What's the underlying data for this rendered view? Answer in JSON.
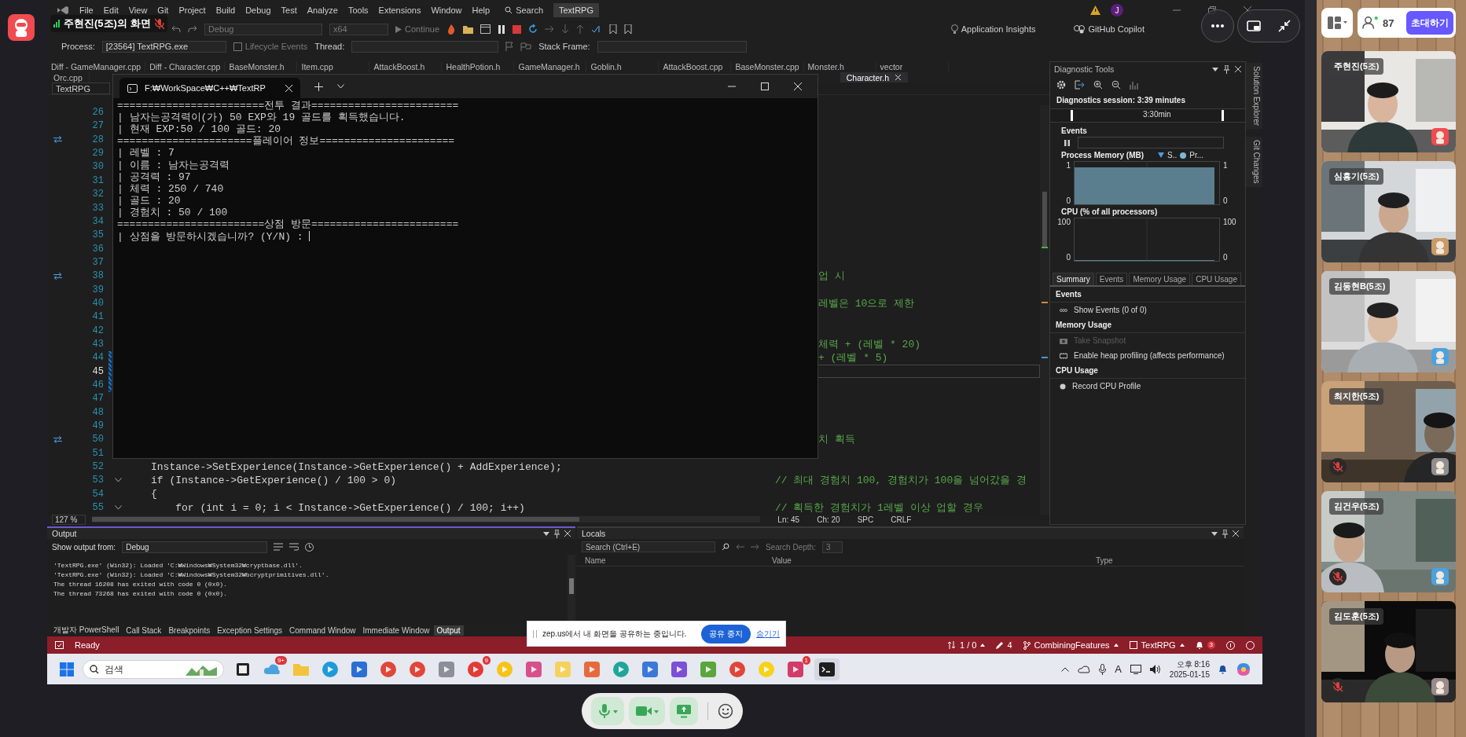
{
  "zep": {
    "presenter_label": "주현진(5조)의 화면",
    "presenter_mic_muted": true,
    "participant_count": "87",
    "invite_button": "초대하기",
    "share_notice": {
      "text": "zep.us에서 내 화면을 공유하는 중입니다.",
      "stop_button": "공유 중지",
      "hide_link": "숨기기"
    },
    "participants": [
      {
        "name": "주현진(5조)",
        "mic_muted": false
      },
      {
        "name": "심흥기(5조)",
        "mic_muted": false
      },
      {
        "name": "김동현B(5조)",
        "mic_muted": false
      },
      {
        "name": "최지한(5조)",
        "mic_muted": true
      },
      {
        "name": "김건우(5조)",
        "mic_muted": true
      },
      {
        "name": "김도훈(5조)",
        "mic_muted": true
      }
    ]
  },
  "visual_studio": {
    "menu": [
      "File",
      "Edit",
      "View",
      "Git",
      "Project",
      "Build",
      "Debug",
      "Test",
      "Analyze",
      "Tools",
      "Extensions",
      "Window",
      "Help"
    ],
    "search": "Search",
    "solution_badge": "TextRPG",
    "account_initial": "J",
    "toolbar": {
      "configuration": "Debug",
      "platform": "x64",
      "continue": "Continue",
      "insights": "Application Insights",
      "copilot": "GitHub Copilot"
    },
    "debug_bar": {
      "process_label": "Process:",
      "process": "[23564] TextRPG.exe",
      "lifecycle": "Lifecycle Events",
      "thread_label": "Thread:",
      "stack_label": "Stack Frame:"
    },
    "tabs_row_1": [
      {
        "label": "Diff - GameManager.cpp",
        "selected": false
      },
      {
        "label": "Diff - Character.cpp",
        "selected": false
      },
      {
        "label": "BaseMonster.h",
        "selected": false
      },
      {
        "label": "Item.cpp",
        "selected": false
      },
      {
        "label": "AttackBoost.h",
        "selected": false
      },
      {
        "label": "HealthPotion.h",
        "selected": false
      },
      {
        "label": "GameManager.h",
        "selected": false
      },
      {
        "label": "Goblin.h",
        "selected": false
      },
      {
        "label": "AttackBoost.cpp",
        "selected": false
      },
      {
        "label": "BaseMonster.cpp",
        "selected": false
      },
      {
        "label": "Monster.h",
        "selected": false
      },
      {
        "label": "vector",
        "selected": false
      }
    ],
    "tabs_row_2": [
      {
        "label": "Orc.cpp",
        "selected": false
      },
      {
        "label": "Character.h",
        "selected": true
      }
    ],
    "scope": "TextRPG",
    "editor": {
      "lines": [
        {
          "number": "26",
          "sync": false,
          "changed": false,
          "fold": false,
          "current": false
        },
        {
          "number": "27",
          "sync": false,
          "changed": false,
          "fold": false,
          "current": false
        },
        {
          "number": "28",
          "sync": true,
          "changed": false,
          "fold": false,
          "current": false
        },
        {
          "number": "29",
          "sync": false,
          "changed": false,
          "fold": false,
          "current": false
        },
        {
          "number": "30",
          "sync": false,
          "changed": false,
          "fold": false,
          "current": false
        },
        {
          "number": "31",
          "sync": false,
          "changed": false,
          "fold": false,
          "current": false
        },
        {
          "number": "32",
          "sync": false,
          "changed": false,
          "fold": false,
          "current": false
        },
        {
          "number": "33",
          "sync": false,
          "changed": false,
          "fold": false,
          "current": false
        },
        {
          "number": "34",
          "sync": false,
          "changed": false,
          "fold": false,
          "current": false
        },
        {
          "number": "35",
          "sync": false,
          "changed": false,
          "fold": false,
          "current": false
        },
        {
          "number": "36",
          "sync": false,
          "changed": false,
          "fold": false,
          "current": false
        },
        {
          "number": "37",
          "sync": false,
          "changed": false,
          "fold": false,
          "current": false
        },
        {
          "number": "38",
          "sync": true,
          "changed": false,
          "fold": false,
          "current": false,
          "tail": "업 시"
        },
        {
          "number": "39",
          "sync": false,
          "changed": false,
          "fold": false,
          "current": false
        },
        {
          "number": "40",
          "sync": false,
          "changed": false,
          "fold": false,
          "current": false,
          "tail": "레벨은 10으로 제한"
        },
        {
          "number": "41",
          "sync": false,
          "changed": false,
          "fold": false,
          "current": false
        },
        {
          "number": "42",
          "sync": false,
          "changed": false,
          "fold": false,
          "current": false
        },
        {
          "number": "43",
          "sync": false,
          "changed": false,
          "fold": false,
          "current": false,
          "tail": "체력 + (레벨 * 20)"
        },
        {
          "number": "44",
          "sync": false,
          "changed": true,
          "fold": false,
          "current": false,
          "tail": "+ (레벨 * 5)"
        },
        {
          "number": "45",
          "sync": false,
          "changed": true,
          "fold": false,
          "current": true
        },
        {
          "number": "46",
          "sync": false,
          "changed": true,
          "fold": false,
          "current": false
        },
        {
          "number": "47",
          "sync": false,
          "changed": false,
          "fold": false,
          "current": false
        },
        {
          "number": "48",
          "sync": false,
          "changed": false,
          "fold": false,
          "current": false
        },
        {
          "number": "49",
          "sync": false,
          "changed": false,
          "fold": false,
          "current": false
        },
        {
          "number": "50",
          "sync": true,
          "changed": false,
          "fold": false,
          "current": false,
          "tail": "치 획득"
        },
        {
          "number": "51",
          "sync": false,
          "changed": false,
          "fold": false,
          "current": false
        },
        {
          "number": "52",
          "sync": false,
          "changed": false,
          "fold": false,
          "current": false,
          "code": "Instance->SetExperience(Instance->GetExperience() + AddExperience);"
        },
        {
          "number": "53",
          "sync": false,
          "changed": false,
          "fold": true,
          "current": false,
          "code": "if (Instance->GetExperience() / 100 > 0)",
          "comment": "// 최대 경험치 100, 경험치가 100을 넘어갔을 경"
        },
        {
          "number": "54",
          "sync": false,
          "changed": false,
          "fold": false,
          "current": false,
          "code": "{"
        },
        {
          "number": "55",
          "sync": false,
          "changed": false,
          "fold": true,
          "current": false,
          "code": "    for (int i = 0; i < Instance->GetExperience() / 100; i++)",
          "comment": "// 획득한 경험치가 1레벨 이상 업할 경우"
        }
      ],
      "zoom": "127 %",
      "line": "Ln: 45",
      "column": "Ch: 20",
      "spacing": "SPC",
      "line_ending": "CRLF"
    },
    "diagnostics": {
      "title": "Diagnostic Tools",
      "session": "Diagnostics session: 3:39 minutes",
      "timeline_label": "3:30min",
      "events_label": "Events",
      "memory": {
        "title": "Process Memory (MB)",
        "legend": [
          "S..",
          "Pr..."
        ],
        "left_ticks": [
          "1",
          "0"
        ],
        "right_ticks": [
          "1",
          "0"
        ]
      },
      "cpu": {
        "title": "CPU (% of all processors)",
        "left_ticks": [
          "100",
          "0"
        ],
        "right_ticks": [
          "100",
          "0"
        ]
      },
      "tabs": [
        {
          "label": "Summary",
          "selected": true
        },
        {
          "label": "Events",
          "selected": false
        },
        {
          "label": "Memory Usage",
          "selected": false
        },
        {
          "label": "CPU Usage",
          "selected": false
        }
      ],
      "sections": [
        {
          "title": "Events",
          "items": [
            {
              "label": "Show Events (0 of 0)",
              "disabled": false
            }
          ]
        },
        {
          "title": "Memory Usage",
          "items": [
            {
              "label": "Take Snapshot",
              "disabled": true
            },
            {
              "label": "Enable heap profiling (affects performance)",
              "disabled": false
            }
          ]
        },
        {
          "title": "CPU Usage",
          "items": [
            {
              "label": "Record CPU Profile",
              "disabled": false
            }
          ]
        }
      ]
    },
    "side_tabs": [
      "Solution Explorer",
      "Git Changes"
    ],
    "output": {
      "title": "Output",
      "source_label": "Show output from:",
      "source": "Debug",
      "lines": [
        "'TextRPG.exe' (Win32): Loaded 'C:₩Windows₩System32₩cryptbase.dll'.",
        "'TextRPG.exe' (Win32): Loaded 'C:₩Windows₩System32₩bcryptprimitives.dll'.",
        "The thread 16208 has exited with code 0 (0x0).",
        "The thread 73268 has exited with code 0 (0x0)."
      ],
      "tabs": [
        {
          "label": "개발자 PowerShell",
          "selected": false
        },
        {
          "label": "Call Stack",
          "selected": false
        },
        {
          "label": "Breakpoints",
          "selected": false
        },
        {
          "label": "Exception Settings",
          "selected": false
        },
        {
          "label": "Command Window",
          "selected": false
        },
        {
          "label": "Immediate Window",
          "selected": false
        },
        {
          "label": "Output",
          "selected": true
        }
      ]
    },
    "locals": {
      "title": "Locals",
      "search_placeholder": "Search (Ctrl+E)",
      "depth_label": "Search Depth:",
      "depth": "3",
      "columns": [
        "Name",
        "Value",
        "Type"
      ]
    },
    "status_bar": {
      "state": "Ready",
      "changes": "1 / 0",
      "edits": "4",
      "branch": "CombiningFeatures",
      "repo": "TextRPG",
      "notifications": "3"
    }
  },
  "console": {
    "title": "F:₩WorkSpace₩C++₩TextRP",
    "cursor": true,
    "lines": [
      "========================전투 결과========================",
      "| 남자는공격력이(가) 50 EXP와 19 골드를 획득했습니다.",
      "| 현재 EXP:50 / 100 골드: 20",
      "======================플레이어 정보======================",
      "| 레벨 : 7",
      "| 이름 : 남자는공격력",
      "| 공격력 : 97",
      "| 체력 : 250 / 740",
      "| 골드 : 20",
      "| 경험치 : 50 / 100",
      "========================상점 방문========================",
      "| 상점을 방문하시겠습니까? (Y/N) : "
    ]
  },
  "taskbar": {
    "search_placeholder": "검색",
    "badges": [
      "9+",
      "9",
      "1"
    ],
    "ime": "A",
    "time": "오후 8:16",
    "date": "2025-01-15"
  }
}
